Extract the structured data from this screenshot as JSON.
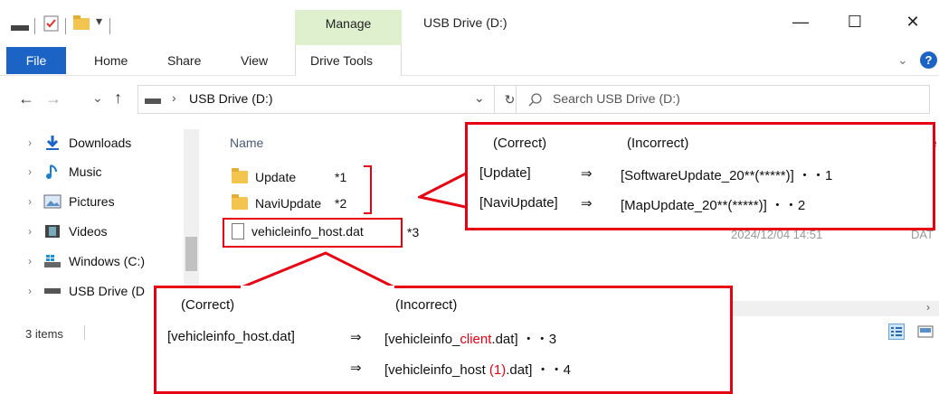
{
  "window": {
    "manage_tab": "Manage",
    "title": "USB Drive (D:)",
    "minimize": "—",
    "maximize": "☐",
    "close": "✕"
  },
  "ribbon": {
    "file": "File",
    "home": "Home",
    "share": "Share",
    "view": "View",
    "drive_tools": "Drive Tools",
    "help": "?"
  },
  "address": {
    "back": "←",
    "forward": "→",
    "recent": "⌄",
    "up": "↑",
    "path_sep": "›",
    "path": "USB Drive (D:)",
    "dropdown": "⌄",
    "refresh": "↻",
    "search_placeholder": "Search USB Drive (D:)"
  },
  "nav": {
    "items": [
      {
        "label": "Downloads",
        "icon": "download-arrow-icon"
      },
      {
        "label": "Music",
        "icon": "music-note-icon"
      },
      {
        "label": "Pictures",
        "icon": "pictures-icon"
      },
      {
        "label": "Videos",
        "icon": "film-icon"
      },
      {
        "label": "Windows (C:)",
        "icon": "windows-drive-icon"
      },
      {
        "label": "USB Drive (D",
        "icon": "usb-drive-icon"
      }
    ]
  },
  "files": {
    "column_name": "Name",
    "rows": [
      {
        "name": "Update",
        "note": "*1"
      },
      {
        "name": "NaviUpdate",
        "note": "*2"
      },
      {
        "name": "vehicleinfo_host.dat",
        "note": "*3",
        "date": "2024/12/04 14:51",
        "type": "DAT"
      }
    ]
  },
  "status": {
    "items": "3 items"
  },
  "callout_top": {
    "correct_header": "(Correct)",
    "incorrect_header": "(Incorrect)",
    "row1_correct": "[Update]",
    "row1_arrow": "⇒",
    "row1_incorrect": "[SoftwareUpdate_20**(*****)] ・・1",
    "row2_correct": "[NaviUpdate]",
    "row2_arrow": "⇒",
    "row2_incorrect": "[MapUpdate_20**(*****)] ・・2"
  },
  "callout_bottom": {
    "correct_header": "(Correct)",
    "incorrect_header": "(Incorrect)",
    "row1_correct": "[vehicleinfo_host.dat]",
    "row1_arrow": "⇒",
    "row1_pre": "[vehicleinfo_",
    "row1_red": "client",
    "row1_post": ".dat] ・・3",
    "row2_arrow": "⇒",
    "row2_pre": "[vehicleinfo_host ",
    "row2_red": "(1)",
    "row2_post": ".dat] ・・4"
  },
  "colors": {
    "accent_blue": "#1b63c4",
    "manage_green": "#dff0cf",
    "callout_red": "#e60012",
    "folder_yellow": "#f3c44e"
  }
}
